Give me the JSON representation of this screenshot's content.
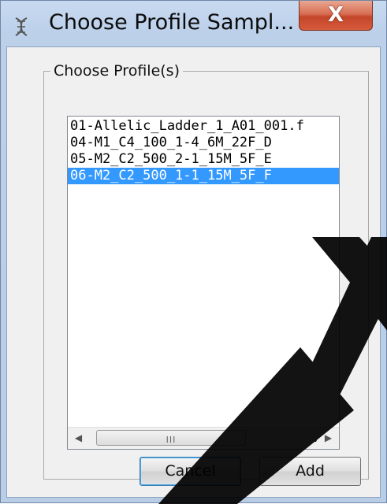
{
  "window": {
    "title": "Choose Profile Sampl...",
    "close_label": "X"
  },
  "group": {
    "label": "Choose Profile(s)"
  },
  "profiles": [
    {
      "name": "01-Allelic_Ladder_1_A01_001.f",
      "selected": false
    },
    {
      "name": "04-M1_C4_100_1-4_6M_22F_D",
      "selected": false
    },
    {
      "name": "05-M2_C2_500_2-1_15M_5F_E",
      "selected": false
    },
    {
      "name": "06-M2_C2_500_1-1_15M_5F_F",
      "selected": true
    }
  ],
  "scrollbar": {
    "left_arrow": "◀",
    "right_arrow": "▶",
    "grip": "III"
  },
  "buttons": {
    "cancel": "Cancel",
    "add": "Add"
  },
  "colors": {
    "selection": "#3399ff",
    "close_button": "#c3462a"
  },
  "icons": {
    "app": "dna-helix-icon"
  }
}
